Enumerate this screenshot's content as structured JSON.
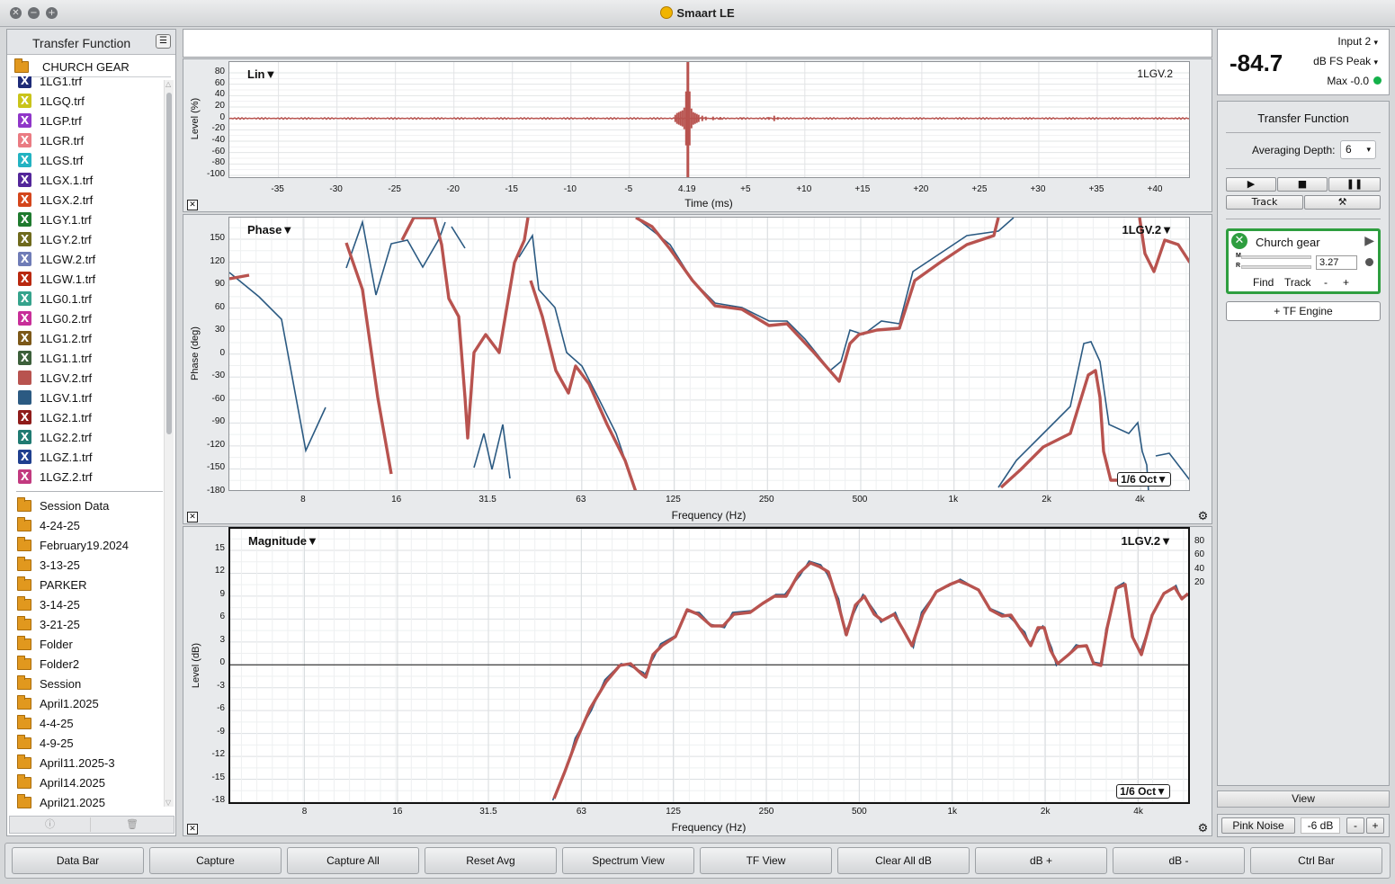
{
  "window": {
    "title": "Smaart LE"
  },
  "browser": {
    "title": "Transfer Function",
    "root_folder": "CHURCH GEAR",
    "files": [
      {
        "name": "1LG1.trf",
        "color": "#1d2a78"
      },
      {
        "name": "1LGQ.trf",
        "color": "#c9c41a"
      },
      {
        "name": "1LGP.trf",
        "color": "#8f36c9"
      },
      {
        "name": "1LGR.trf",
        "color": "#ea7b82"
      },
      {
        "name": "1LGS.trf",
        "color": "#23b3c2"
      },
      {
        "name": "1LGX.1.trf",
        "color": "#53269a"
      },
      {
        "name": "1LGX.2.trf",
        "color": "#d4461c"
      },
      {
        "name": "1LGY.1.trf",
        "color": "#1f7a2e"
      },
      {
        "name": "1LGY.2.trf",
        "color": "#6f6a1c"
      },
      {
        "name": "1LGW.2.trf",
        "color": "#6f7cb7"
      },
      {
        "name": "1LGW.1.trf",
        "color": "#b9280f"
      },
      {
        "name": "1LG0.1.trf",
        "color": "#35a38c"
      },
      {
        "name": "1LG0.2.trf",
        "color": "#c82e99"
      },
      {
        "name": "1LG1.2.trf",
        "color": "#7c5818"
      },
      {
        "name": "1LG1.1.trf",
        "color": "#3c5f3a"
      },
      {
        "name": "1LGV.2.trf",
        "color": "#b8534f"
      },
      {
        "name": "1LGV.1.trf",
        "color": "#2b5a82"
      },
      {
        "name": "1LG2.1.trf",
        "color": "#8f1c1a"
      },
      {
        "name": "1LG2.2.trf",
        "color": "#1f7a72"
      },
      {
        "name": "1LGZ.1.trf",
        "color": "#1f3f8f"
      },
      {
        "name": "1LGZ.2.trf",
        "color": "#c23a7f"
      }
    ],
    "folders": [
      "Session Data",
      "4-24-25",
      "February19.2024",
      "3-13-25",
      "PARKER",
      "3-14-25",
      "3-21-25",
      "Folder",
      "Folder2",
      "Session",
      "April1.2025",
      "4-4-25",
      "4-9-25",
      "April11.2025-3",
      "April14.2025",
      "April21.2025"
    ],
    "footer": {
      "info": "ⓘ",
      "trash": "🗑"
    }
  },
  "plots": {
    "impulse": {
      "title": "Lin",
      "trace": "1LGV.2",
      "ylabel": "Level (%)",
      "xlabel": "Time (ms)",
      "yticks": [
        "80",
        "60",
        "40",
        "20",
        "0",
        "-20",
        "-40",
        "-60",
        "-80",
        "-100"
      ],
      "xticks": [
        "-35",
        "-30",
        "-25",
        "-20",
        "-15",
        "-10",
        "-5",
        "4.19",
        "+5",
        "+10",
        "+15",
        "+20",
        "+25",
        "+30",
        "+35",
        "+40"
      ]
    },
    "phase": {
      "title": "Phase",
      "trace": "1LGV.2",
      "ylabel": "Phase (deg)",
      "xlabel": "Frequency (Hz)",
      "smoothing": "1/6 Oct",
      "yticks": [
        "150",
        "120",
        "90",
        "60",
        "30",
        "0",
        "-30",
        "-60",
        "-90",
        "-120",
        "-150",
        "-180"
      ],
      "xticks": [
        "8",
        "16",
        "31.5",
        "63",
        "125",
        "250",
        "500",
        "1k",
        "2k",
        "4k"
      ]
    },
    "magnitude": {
      "title": "Magnitude",
      "trace": "1LGV.2",
      "ylabel": "Level (dB)",
      "xlabel": "Frequency (Hz)",
      "smoothing": "1/6 Oct",
      "yticks": [
        "15",
        "12",
        "9",
        "6",
        "3",
        "0",
        "-3",
        "-6",
        "-9",
        "-12",
        "-15",
        "-18"
      ],
      "coherence_ticks": [
        "80",
        "60",
        "40",
        "20"
      ],
      "xticks": [
        "8",
        "16",
        "31.5",
        "63",
        "125",
        "250",
        "500",
        "1k",
        "2k",
        "4k"
      ]
    }
  },
  "meter": {
    "value": "-84.7",
    "input": "Input 2",
    "unit": "dB FS Peak",
    "max": "Max -0.0"
  },
  "control": {
    "title": "Transfer Function",
    "averaging_label": "Averaging Depth:",
    "averaging_value": "6",
    "track_label": "Track",
    "engine": {
      "name": "Church gear",
      "delay": "3.27",
      "find": "Find",
      "track": "Track",
      "minus": "-",
      "plus": "+",
      "m": "M",
      "r": "R"
    },
    "add_engine": "+ TF Engine"
  },
  "view_label": "View",
  "generator": {
    "label": "Pink Noise",
    "level": "-6 dB",
    "minus": "-",
    "plus": "+"
  },
  "commands": [
    "Data Bar",
    "Capture",
    "Capture All",
    "Reset Avg",
    "Spectrum View",
    "TF View",
    "Clear All dB",
    "dB +",
    "dB -",
    "Ctrl Bar"
  ],
  "colors": {
    "measured": "#b8534f",
    "reference": "#2b5a82",
    "engine_active": "#2e9e3f"
  }
}
